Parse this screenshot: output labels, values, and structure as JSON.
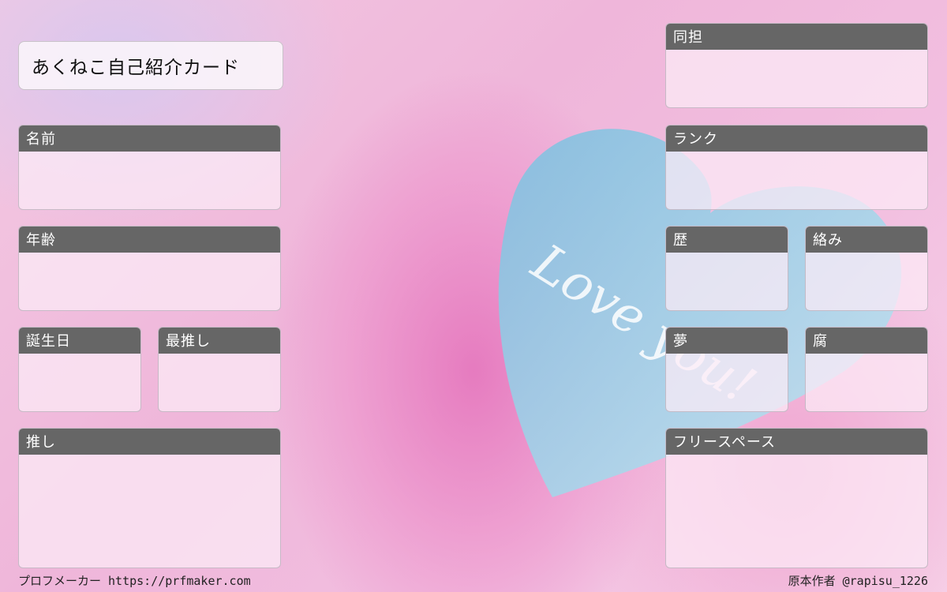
{
  "title": "あくねこ自己紹介カード",
  "background_text": "Love you!",
  "colors": {
    "header": "#666666",
    "heart": "#8ec8e2"
  },
  "cards": {
    "name": "名前",
    "age": "年齢",
    "birthday": "誕生日",
    "favorite": "最推し",
    "oshi": "推し",
    "doutan": "同担",
    "rank": "ランク",
    "history": "歴",
    "karami": "絡み",
    "yume": "夢",
    "fu": "腐",
    "free_space": "フリースペース"
  },
  "footer": {
    "left": "プロフメーカー https://prfmaker.com",
    "right": "原本作者 @rapisu_1226"
  }
}
